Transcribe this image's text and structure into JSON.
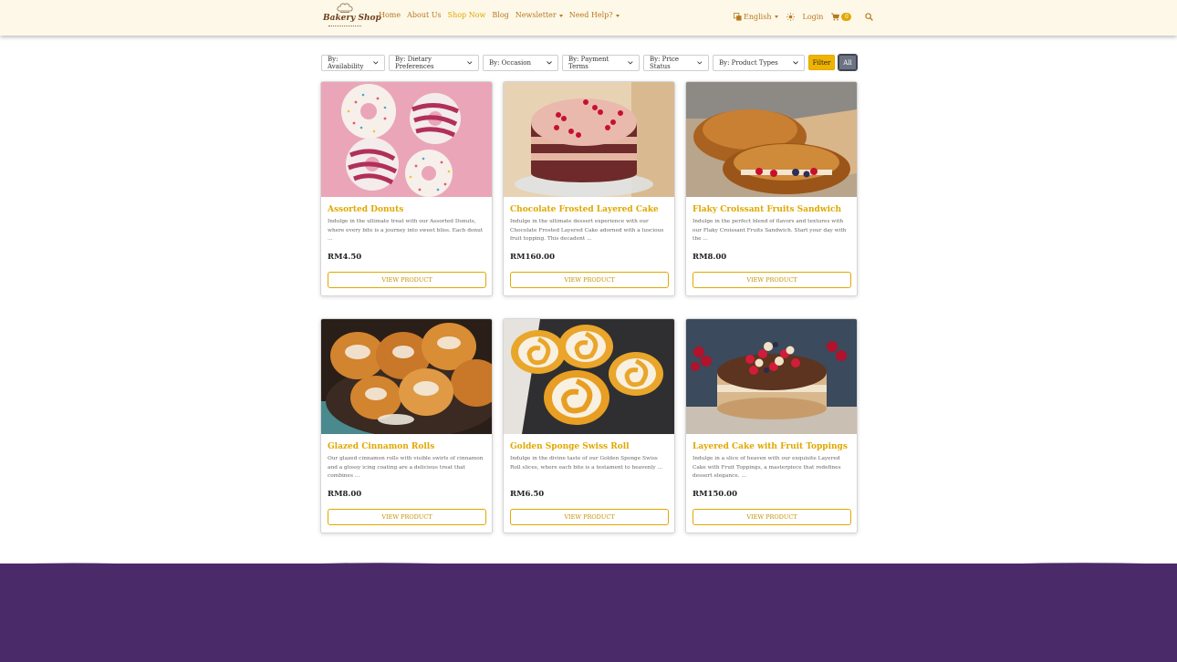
{
  "header": {
    "logo_text": "Bakery Shop",
    "nav": [
      {
        "label": "Home",
        "dropdown": false,
        "active": false
      },
      {
        "label": "About Us",
        "dropdown": false,
        "active": false
      },
      {
        "label": "Shop Now",
        "dropdown": false,
        "active": true
      },
      {
        "label": "Blog",
        "dropdown": false,
        "active": false
      },
      {
        "label": "Newsletter",
        "dropdown": true,
        "active": false
      },
      {
        "label": "Need Help?",
        "dropdown": true,
        "active": false
      }
    ],
    "language": "English",
    "login": "Login",
    "cart_count": "0"
  },
  "filters": {
    "availability": "By: Availability",
    "dietary": "By: Dietary Preferences",
    "occasion": "By: Occasion",
    "payment": "By: Payment Terms",
    "price_status": "By: Price Status",
    "product_types": "By: Product Types",
    "filter_button": "Filter",
    "all_button": "All"
  },
  "products": [
    {
      "title": "Assorted Donuts",
      "description": "Indulge in the ultimate treat with our Assorted Donuts, where every bite is a journey into sweet bliss. Each donut ...",
      "price": "RM4.50",
      "button": "VIEW PRODUCT"
    },
    {
      "title": "Chocolate Frosted Layered Cake",
      "description": "Indulge in the ultimate dessert experience with our Chocolate Frosted Layered Cake adorned with a luscious fruit topping. This decadent ...",
      "price": "RM160.00",
      "button": "VIEW PRODUCT"
    },
    {
      "title": "Flaky Croissant Fruits Sandwich",
      "description": "Indulge in the perfect blend of flavors and textures with our Flaky Croissant Fruits Sandwich. Start your day with the ...",
      "price": "RM8.00",
      "button": "VIEW PRODUCT"
    },
    {
      "title": "Glazed Cinnamon Rolls",
      "description": "Our glazed cinnamon rolls with visible swirls of cinnamon and a glossy icing coating are a delicious treat that combines ...",
      "price": "RM8.00",
      "button": "VIEW PRODUCT"
    },
    {
      "title": "Golden Sponge Swiss Roll",
      "description": "Indulge in the divine taste of our Golden Sponge Swiss Roll slices, where each bite is a testament to heavenly ...",
      "price": "RM6.50",
      "button": "VIEW PRODUCT"
    },
    {
      "title": "Layered Cake with Fruit Toppings",
      "description": "Indulge in a slice of heaven with our exquisite Layered Cake with Fruit Toppings, a masterpiece that redefines dessert elegance. ...",
      "price": "RM150.00",
      "button": "VIEW PRODUCT"
    }
  ],
  "colors": {
    "accent": "#e0a800",
    "header_bg": "#fdf8e8",
    "footer_bg": "#4a2a68"
  }
}
